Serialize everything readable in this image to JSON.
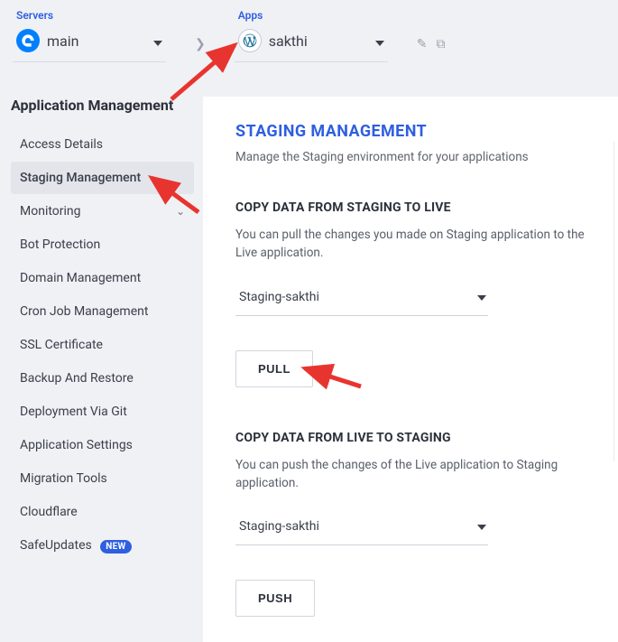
{
  "topbar": {
    "servers_label": "Servers",
    "server_name": "main",
    "apps_label": "Apps",
    "app_name": "sakthi"
  },
  "sidebar": {
    "title": "Application Management",
    "items": [
      {
        "label": "Access Details"
      },
      {
        "label": "Staging Management",
        "active": true
      },
      {
        "label": "Monitoring",
        "expandable": true
      },
      {
        "label": "Bot Protection"
      },
      {
        "label": "Domain Management"
      },
      {
        "label": "Cron Job Management"
      },
      {
        "label": "SSL Certificate"
      },
      {
        "label": "Backup And Restore"
      },
      {
        "label": "Deployment Via Git"
      },
      {
        "label": "Application Settings"
      },
      {
        "label": "Migration Tools"
      },
      {
        "label": "Cloudflare"
      },
      {
        "label": "SafeUpdates",
        "badge": "NEW"
      }
    ]
  },
  "main": {
    "heading": "STAGING MANAGEMENT",
    "subtitle": "Manage the Staging environment for your applications",
    "staging_to_live": {
      "title": "COPY DATA FROM STAGING TO LIVE",
      "desc": "You can pull the changes you made on Staging application to the Live application.",
      "select_value": "Staging-sakthi",
      "button": "PULL"
    },
    "live_to_staging": {
      "title": "COPY DATA FROM LIVE TO STAGING",
      "desc": "You can push the changes of the Live application to Staging application.",
      "select_value": "Staging-sakthi",
      "button": "PUSH"
    }
  }
}
